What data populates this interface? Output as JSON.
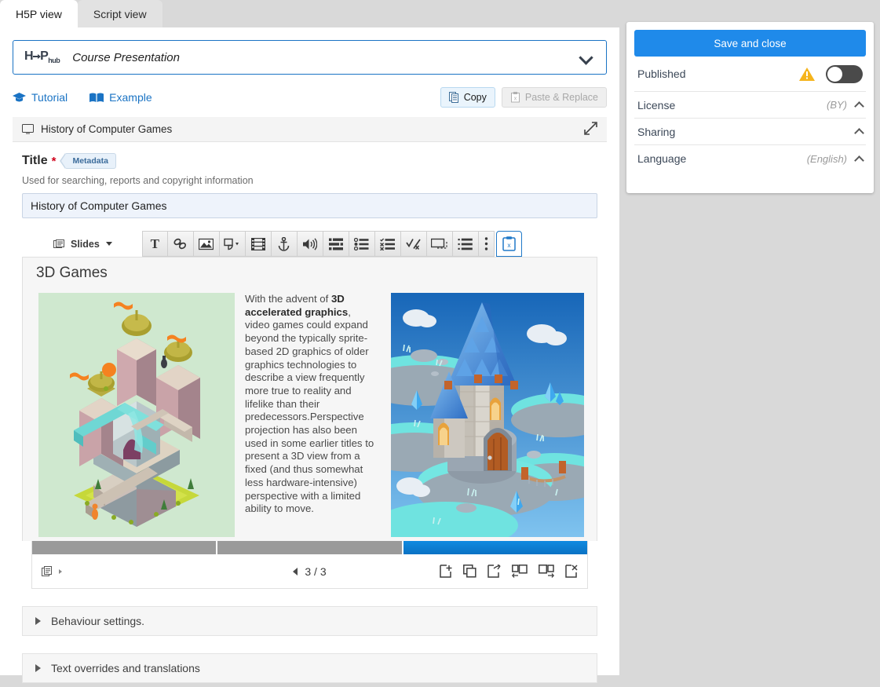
{
  "tabs": [
    {
      "label": "H5P view",
      "active": true
    },
    {
      "label": "Script view",
      "active": false
    }
  ],
  "library": {
    "logo_h": "H",
    "logo_p": "P",
    "logo_sub": "hub",
    "name": "Course Presentation"
  },
  "links": {
    "tutorial": "Tutorial",
    "example": "Example",
    "copy": "Copy",
    "paste": "Paste & Replace"
  },
  "content_bar": {
    "title": "History of Computer Games"
  },
  "title_field": {
    "label": "Title",
    "required_mark": "*",
    "metadata_badge": "Metadata",
    "description": "Used for searching, reports and copyright information",
    "value": "History of Computer Games"
  },
  "slide_toolbar": {
    "slides_menu": "Slides",
    "buttons": [
      {
        "name": "text-tool",
        "glyph": "T"
      },
      {
        "name": "link-tool",
        "glyph": "link"
      },
      {
        "name": "image-tool",
        "glyph": "image"
      },
      {
        "name": "shape-tool",
        "glyph": "shape"
      },
      {
        "name": "video-tool",
        "glyph": "film"
      },
      {
        "name": "hotspot-tool",
        "glyph": "anchor"
      },
      {
        "name": "audio-tool",
        "glyph": "speaker"
      },
      {
        "name": "drag-drop-tool",
        "glyph": "dragdrop"
      },
      {
        "name": "single-choice-tool",
        "glyph": "singlechoice"
      },
      {
        "name": "multi-choice-tool",
        "glyph": "multichoice"
      },
      {
        "name": "true-false-tool",
        "glyph": "truefalse"
      },
      {
        "name": "fill-blanks-tool",
        "glyph": "blanks"
      },
      {
        "name": "summary-tool",
        "glyph": "list"
      },
      {
        "name": "more-tools",
        "glyph": "dots"
      },
      {
        "name": "paste-tool",
        "glyph": "paste"
      }
    ]
  },
  "slide": {
    "title": "3D Games",
    "body_pre_bold": "With the advent of ",
    "body_bold": "3D accelerated graphics",
    "body_post_bold": ", video games could expand beyond the typically sprite-based 2D graphics of older graphics technologies to describe a view frequently more true to reality and lifelike than their predecessors.Perspective projection has also been used in some earlier titles to present a 3D view from a fixed (and thus somewhat less hardware-intensive) perspective with a limited ability to move.",
    "left_image_alt": "isometric-architecture-illustration",
    "right_image_alt": "3d-fantasy-tower-render"
  },
  "slide_nav": {
    "counter": "3 / 3",
    "current": 3,
    "total": 3,
    "actions": [
      "add-slide",
      "clone-slide",
      "copy-slide",
      "move-slide-left",
      "move-slide-right",
      "delete-slide"
    ]
  },
  "collapsibles": [
    {
      "label": "Behaviour settings."
    },
    {
      "label": "Text overrides and translations"
    }
  ],
  "right_panel": {
    "save_label": "Save and close",
    "published_label": "Published",
    "published_on": false,
    "rows": [
      {
        "label": "License",
        "value": "(BY)"
      },
      {
        "label": "Sharing",
        "value": ""
      },
      {
        "label": "Language",
        "value": "(English)"
      }
    ]
  },
  "colors": {
    "accent_blue": "#1f8aea",
    "link_blue": "#1a73c4",
    "warning_yellow": "#f5b41c",
    "required_red": "#d0021b",
    "page_bg": "#d9d9d9"
  }
}
